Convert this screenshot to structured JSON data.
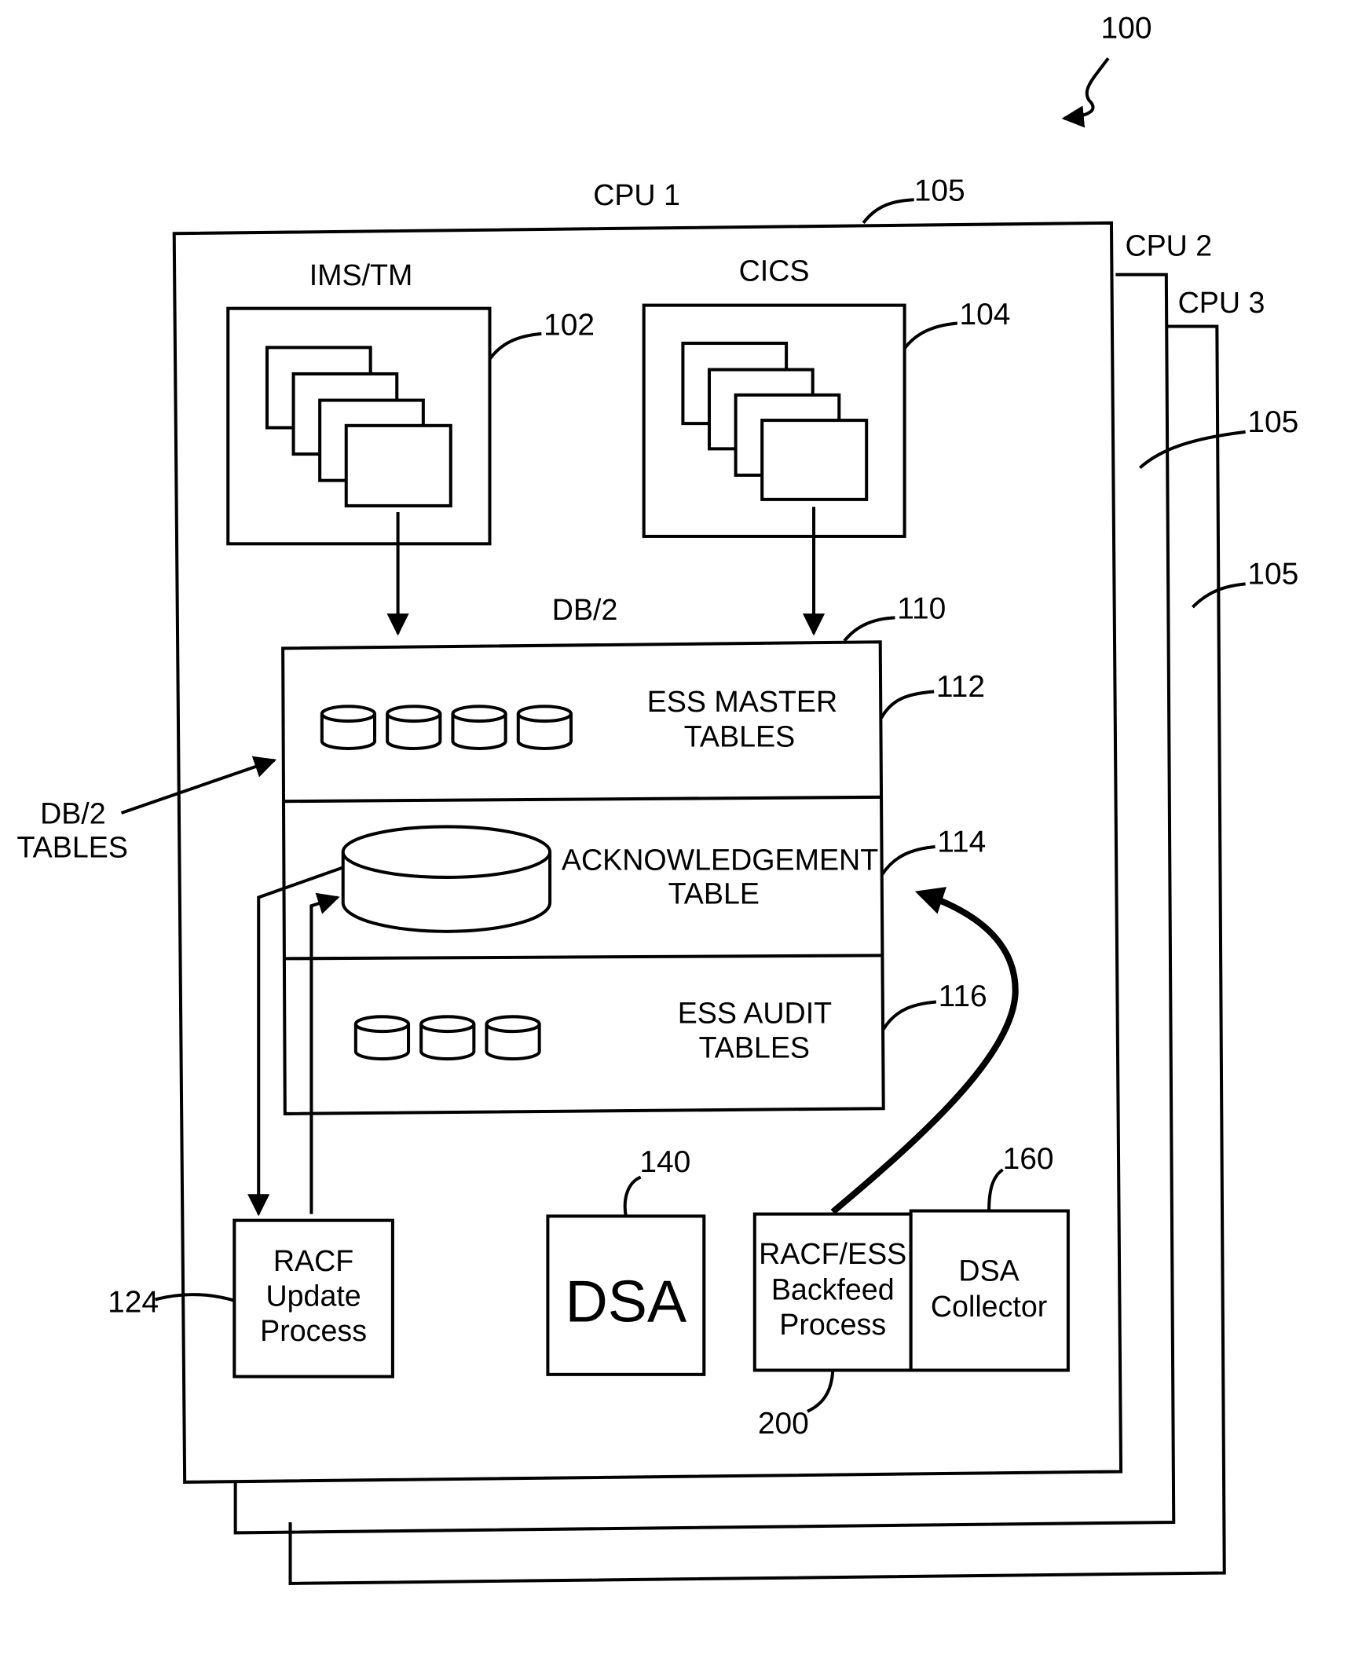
{
  "figure": {
    "ref": "100",
    "cpus": [
      {
        "label": "CPU 1",
        "ref": "105"
      },
      {
        "label": "CPU 2",
        "ref": "105"
      },
      {
        "label": "CPU 3",
        "ref": "105"
      }
    ],
    "ims": {
      "label": "IMS/TM",
      "ref": "102"
    },
    "cics": {
      "label": "CICS",
      "ref": "104"
    },
    "db2": {
      "label": "DB/2",
      "ref": "110",
      "side_label_line1": "DB/2",
      "side_label_line2": "TABLES",
      "sections": [
        {
          "line1": "ESS MASTER",
          "line2": "TABLES",
          "ref": "112",
          "cylinders": 4
        },
        {
          "line1": "ACKNOWLEDGEMENT",
          "line2": "TABLE",
          "ref": "114",
          "cylinders": 1
        },
        {
          "line1": "ESS AUDIT",
          "line2": "TABLES",
          "ref": "116",
          "cylinders": 3
        }
      ]
    },
    "racf_update": {
      "lines": [
        "RACF",
        "Update",
        "Process"
      ],
      "ref": "124"
    },
    "dsa": {
      "label": "DSA",
      "ref": "140"
    },
    "backfeed": {
      "lines": [
        "RACF/ESS",
        "Backfeed",
        "Process"
      ],
      "ref": "200"
    },
    "collector": {
      "lines": [
        "DSA",
        "Collector"
      ],
      "ref": "160"
    }
  }
}
